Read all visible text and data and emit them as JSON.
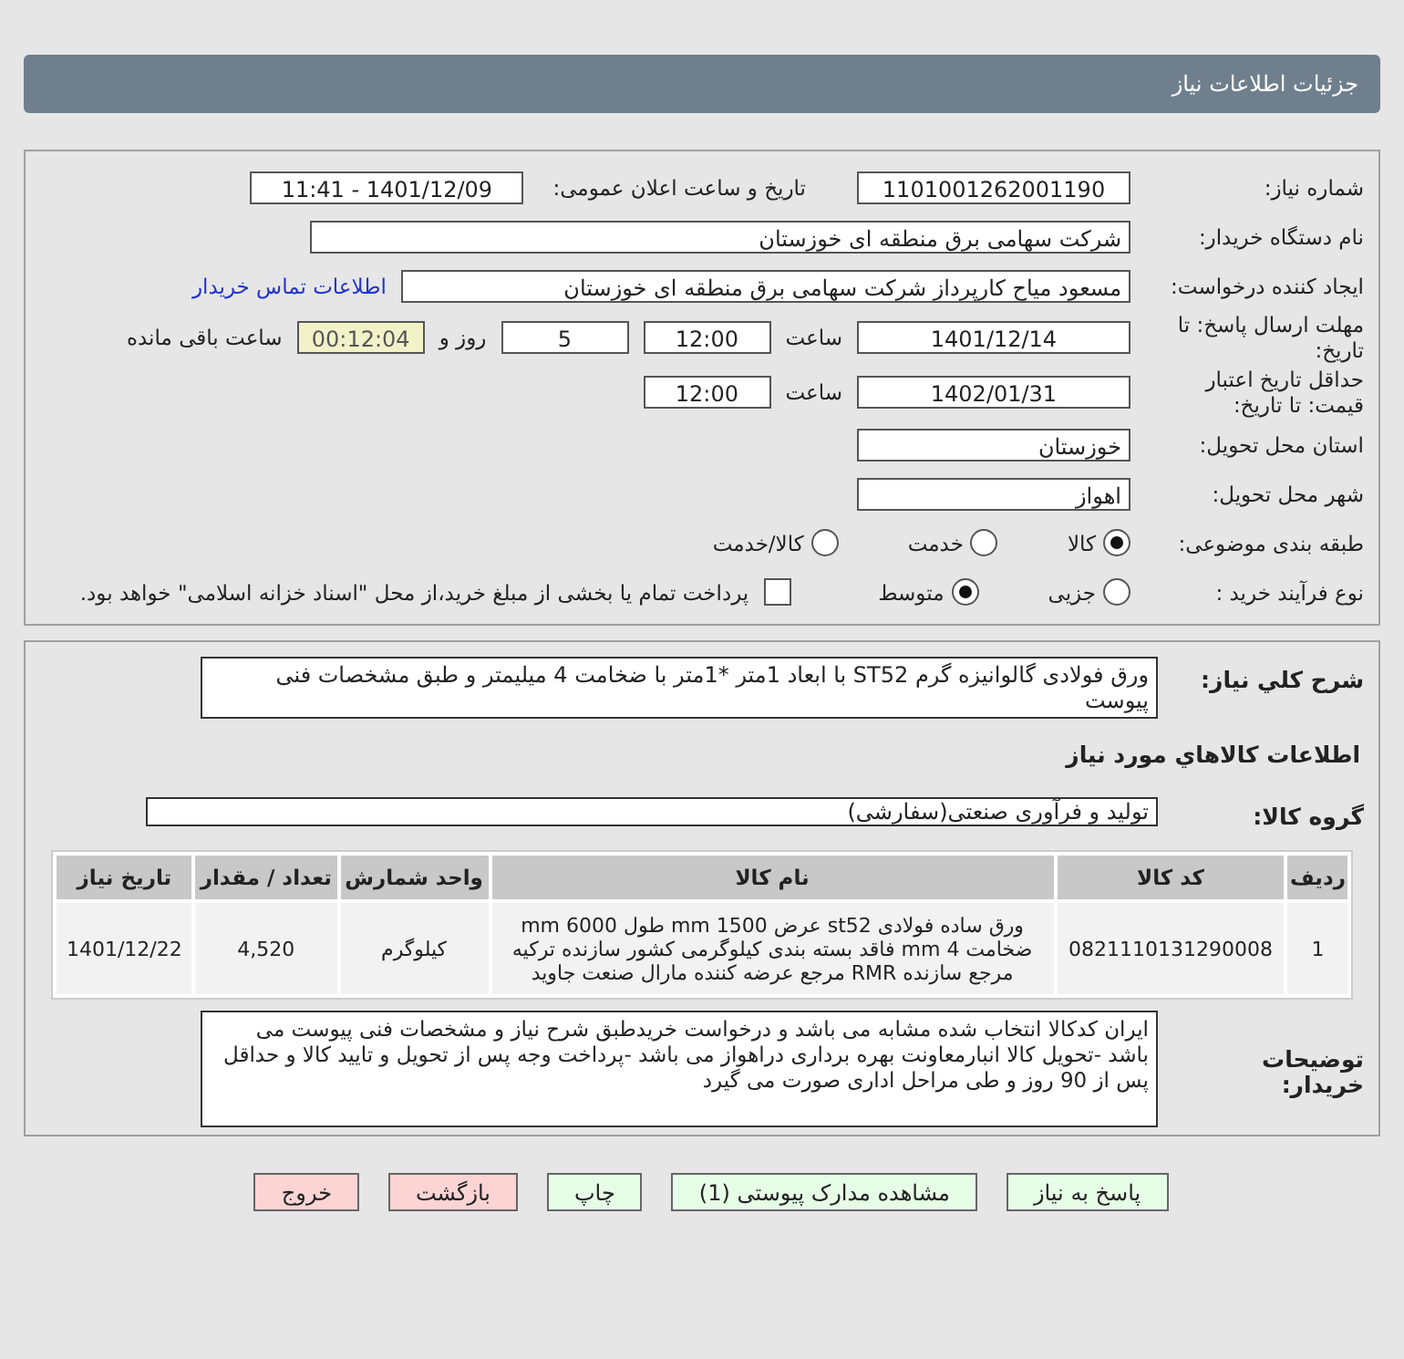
{
  "header": {
    "title": "جزئیات اطلاعات نیاز"
  },
  "details": {
    "need_number": {
      "label": "شماره نیاز:",
      "value": "1101001262001190"
    },
    "announce": {
      "label": "تاریخ و ساعت اعلان عمومی:",
      "value": "1401/12/09 - 11:41"
    },
    "buyer": {
      "label": "نام دستگاه خریدار:",
      "value": "شرکت سهامی برق منطقه ای خوزستان"
    },
    "creator": {
      "label": "ایجاد کننده درخواست:",
      "value": "مسعود میاح کارپرداز شرکت سهامی برق منطقه ای خوزستان",
      "link": "اطلاعات تماس خریدار"
    },
    "deadline": {
      "label": "مهلت ارسال پاسخ: تا تاریخ:",
      "date": "1401/12/14",
      "time_label": "ساعت",
      "time": "12:00",
      "days": "5",
      "days_label": "روز و",
      "remaining": "00:12:04",
      "remaining_label": "ساعت باقی مانده"
    },
    "validity": {
      "label": "حداقل تاریخ اعتبار قیمت: تا تاریخ:",
      "date": "1402/01/31",
      "time_label": "ساعت",
      "time": "12:00"
    },
    "province": {
      "label": "استان محل تحویل:",
      "value": "خوزستان"
    },
    "city": {
      "label": "شهر محل تحویل:",
      "value": "اهواز"
    },
    "category": {
      "label": "طبقه بندی موضوعی:",
      "options": [
        {
          "label": "کالا",
          "selected": true
        },
        {
          "label": "خدمت",
          "selected": false
        },
        {
          "label": "کالا/خدمت",
          "selected": false
        }
      ]
    },
    "purchase_type": {
      "label": "نوع فرآیند خرید :",
      "options": [
        {
          "label": "جزیی",
          "selected": false
        },
        {
          "label": "متوسط",
          "selected": true
        }
      ],
      "payment": {
        "label": "پرداخت تمام یا بخشی از مبلغ خرید،از محل \"اسناد خزانه اسلامی\" خواهد بود.",
        "checked": false
      }
    }
  },
  "summary": {
    "label": "شرح کلي نياز:",
    "value": "ورق فولادی گالوانیزه گرم ST52 با ابعاد 1متر *1متر با ضخامت 4 میلیمتر و طبق مشخصات فنی پیوست"
  },
  "goods_heading": "اطلاعات كالاهاي مورد نياز",
  "goods_group": {
    "label": "گروه کالا:",
    "value": "تولید و فرآوری صنعتی(سفارشی)"
  },
  "table": {
    "columns": [
      "ردیف",
      "کد کالا",
      "نام کالا",
      "واحد شمارش",
      "تعداد / مقدار",
      "تاریخ نیاز"
    ],
    "rows": [
      [
        "1",
        "0821110131290008",
        "ورق ساده فولادی st52 عرض 1500 mm طول 6000 mm ضخامت 4 mm فاقد بسته بندی کیلوگرمی کشور سازنده ترکیه مرجع سازنده RMR مرجع عرضه کننده مارال صنعت جاوید",
        "کیلوگرم",
        "4,520",
        "1401/12/22"
      ]
    ]
  },
  "notes": {
    "label": "توضیحات خریدار:",
    "value": "ایران کدکالا انتخاب شده مشابه می باشد و درخواست خریدطبق شرح نیاز و مشخصات فنی پیوست می باشد -تحویل کالا انبارمعاونت بهره برداری دراهواز می باشد -پرداخت وجه پس از تحویل و تایید کالا و حداقل پس از 90 روز و طی مراحل اداری صورت می گیرد"
  },
  "buttons": [
    {
      "label": "پاسخ به نیاز",
      "kind": "primary"
    },
    {
      "label": "مشاهده مدارک پیوستی (1)",
      "kind": "primary"
    },
    {
      "label": "چاپ",
      "kind": "primary"
    },
    {
      "label": "بازگشت",
      "kind": "danger"
    },
    {
      "label": "خروج",
      "kind": "danger"
    }
  ]
}
